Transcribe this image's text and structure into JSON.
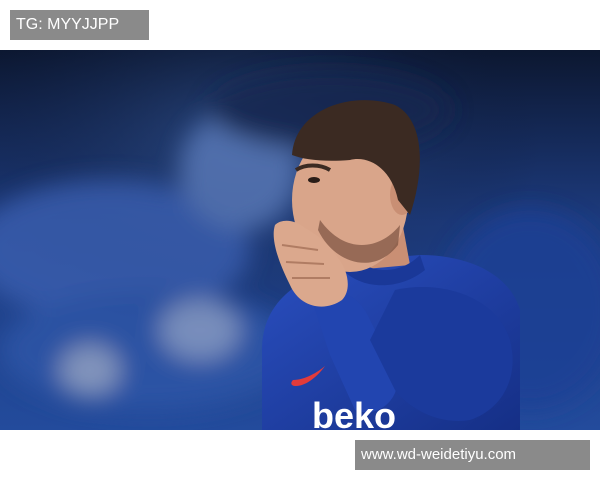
{
  "top_label": "TG: MYYJJPP",
  "photo": {
    "jersey_sponsor": "beko",
    "colors": {
      "background_dark": "#0d1a3a",
      "crowd_blue": "#2c4f9e",
      "jersey_blue": "#1f3fa8",
      "skin": "#d9a58a",
      "hair": "#3b2a22"
    }
  },
  "bottom_label": "www.wd-weidetiyu.com"
}
